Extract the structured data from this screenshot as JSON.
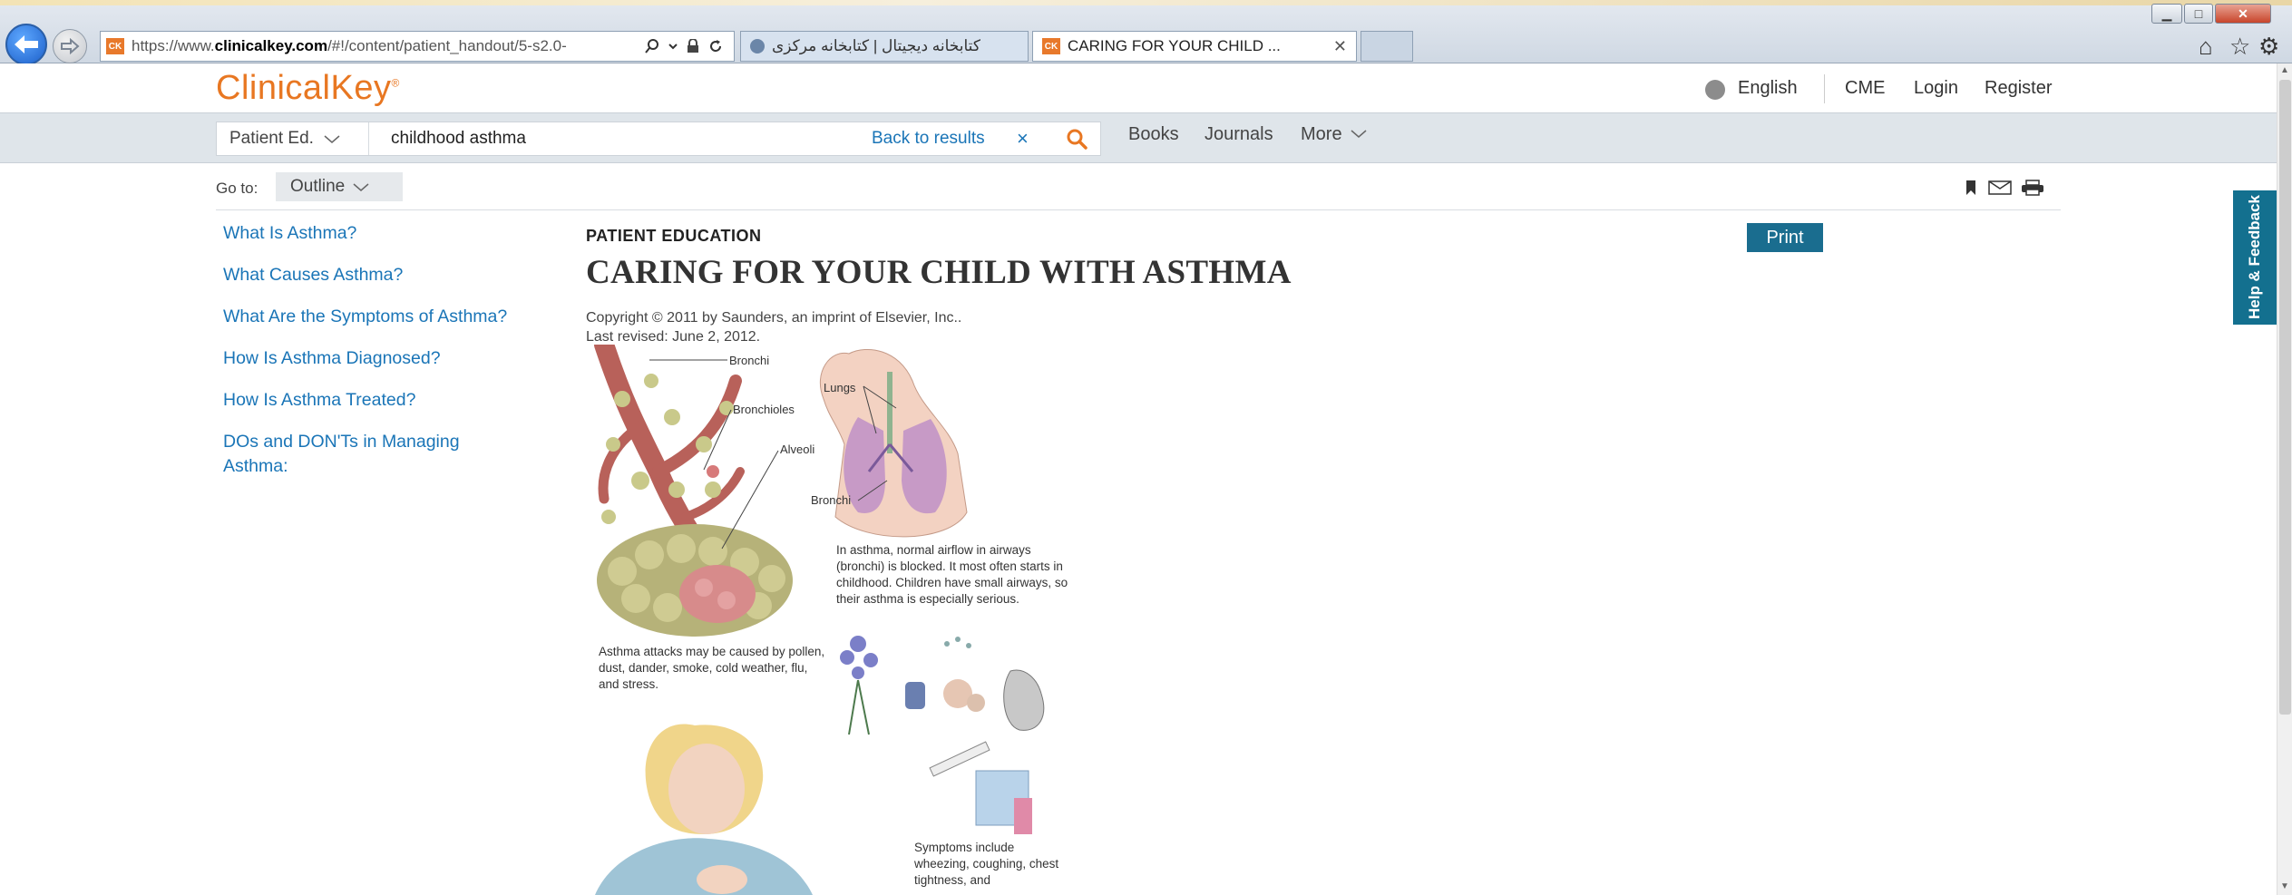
{
  "browser": {
    "url_prefix": "https://www.",
    "url_domain": "clinicalkey.com",
    "url_path": "/#!/content/patient_handout/5-s2.0-",
    "favicon_text": "CK",
    "tabs": [
      {
        "title": "کتابخانه دیجیتال | کتابخانه مرکزی"
      },
      {
        "title": "CARING FOR YOUR CHILD ..."
      }
    ],
    "win_min": "▁",
    "win_max": "□",
    "win_close": "✕"
  },
  "header": {
    "logo": "ClinicalKey",
    "logo_mark": "®",
    "language": "English",
    "cme": "CME",
    "login": "Login",
    "register": "Register"
  },
  "search": {
    "scope": "Patient Ed.",
    "term": "childhood asthma",
    "back_to_results": "Back to results",
    "clear": "×"
  },
  "nav": {
    "books": "Books",
    "journals": "Journals",
    "more": "More"
  },
  "goto": {
    "label": "Go to:",
    "outline": "Outline"
  },
  "outline": [
    "What Is Asthma?",
    "What Causes Asthma?",
    "What Are the Symptoms of Asthma?",
    "How Is Asthma Diagnosed?",
    "How Is Asthma Treated?",
    "DOs and DON'Ts in Managing Asthma:"
  ],
  "article": {
    "kicker": "PATIENT EDUCATION",
    "title": "CARING FOR YOUR CHILD WITH ASTHMA",
    "copyright": "Copyright © 2011 by Saunders, an imprint of Elsevier, Inc..",
    "revised": "Last revised: June 2, 2012.",
    "print": "Print"
  },
  "illustration": {
    "labels": {
      "bronchi_top": "Bronchi",
      "lungs": "Lungs",
      "bronchioles": "Bronchioles",
      "alveoli": "Alveoli",
      "bronchi_bottom": "Bronchi"
    },
    "caption_airways": "In asthma, normal airflow in airways (bronchi) is blocked. It most often starts in childhood. Children have small airways, so their asthma is especially serious.",
    "caption_triggers": "Asthma attacks may be caused by pollen, dust, dander, smoke, cold weather, flu, and stress.",
    "caption_symptoms": "Symptoms include wheezing, coughing, chest tightness, and"
  },
  "feedback": "Help & Feedback",
  "colors": {
    "brand_orange": "#e87722",
    "link_blue": "#1a75b7",
    "print_teal": "#1a6d8f",
    "feedback_teal": "#13708f"
  }
}
